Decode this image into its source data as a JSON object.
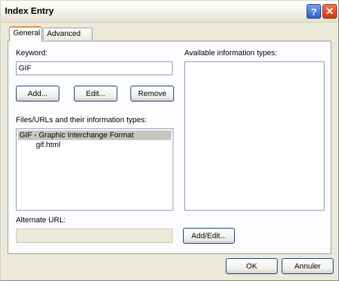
{
  "window": {
    "title": "Index Entry"
  },
  "titlebar": {
    "help_glyph": "?",
    "close_glyph": "✕"
  },
  "tabs": [
    {
      "label": "General",
      "active": true
    },
    {
      "label": "Advanced",
      "active": false
    }
  ],
  "keyword": {
    "label": "Keyword:",
    "value": "GIF"
  },
  "buttons": {
    "add": "Add...",
    "edit": "Edit...",
    "remove": "Remove",
    "add_edit": "Add/Edit...",
    "ok": "OK",
    "cancel": "Annuler"
  },
  "files": {
    "label": "Files/URLs and their information types:",
    "items": [
      "GIF - Graphic Interchange Format",
      "gif.html"
    ]
  },
  "available_types": {
    "label": "Available information types:"
  },
  "alternate_url": {
    "label": "Alternate URL:",
    "value": ""
  },
  "icons": {
    "help": "question-icon",
    "close": "close-icon"
  }
}
